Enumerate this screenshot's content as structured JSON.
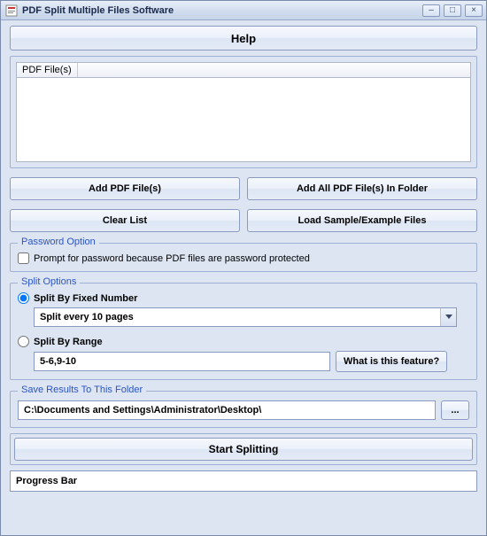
{
  "window": {
    "title": "PDF Split Multiple Files Software"
  },
  "help_label": "Help",
  "file_list": {
    "header": "PDF File(s)"
  },
  "buttons": {
    "add": "Add PDF File(s)",
    "add_folder": "Add All PDF File(s) In Folder",
    "clear": "Clear List",
    "load_sample": "Load Sample/Example Files"
  },
  "password": {
    "legend": "Password Option",
    "prompt_label": "Prompt for password because PDF files are password protected"
  },
  "split": {
    "legend": "Split Options",
    "by_fixed_label": "Split By Fixed Number",
    "fixed_value": "Split every 10 pages",
    "by_range_label": "Split By Range",
    "range_value": "5-6,9-10",
    "what_is_label": "What is this feature?"
  },
  "save": {
    "legend": "Save Results To This Folder",
    "path": "C:\\Documents and Settings\\Administrator\\Desktop\\",
    "browse": "..."
  },
  "start_label": "Start Splitting",
  "progress_label": "Progress Bar"
}
